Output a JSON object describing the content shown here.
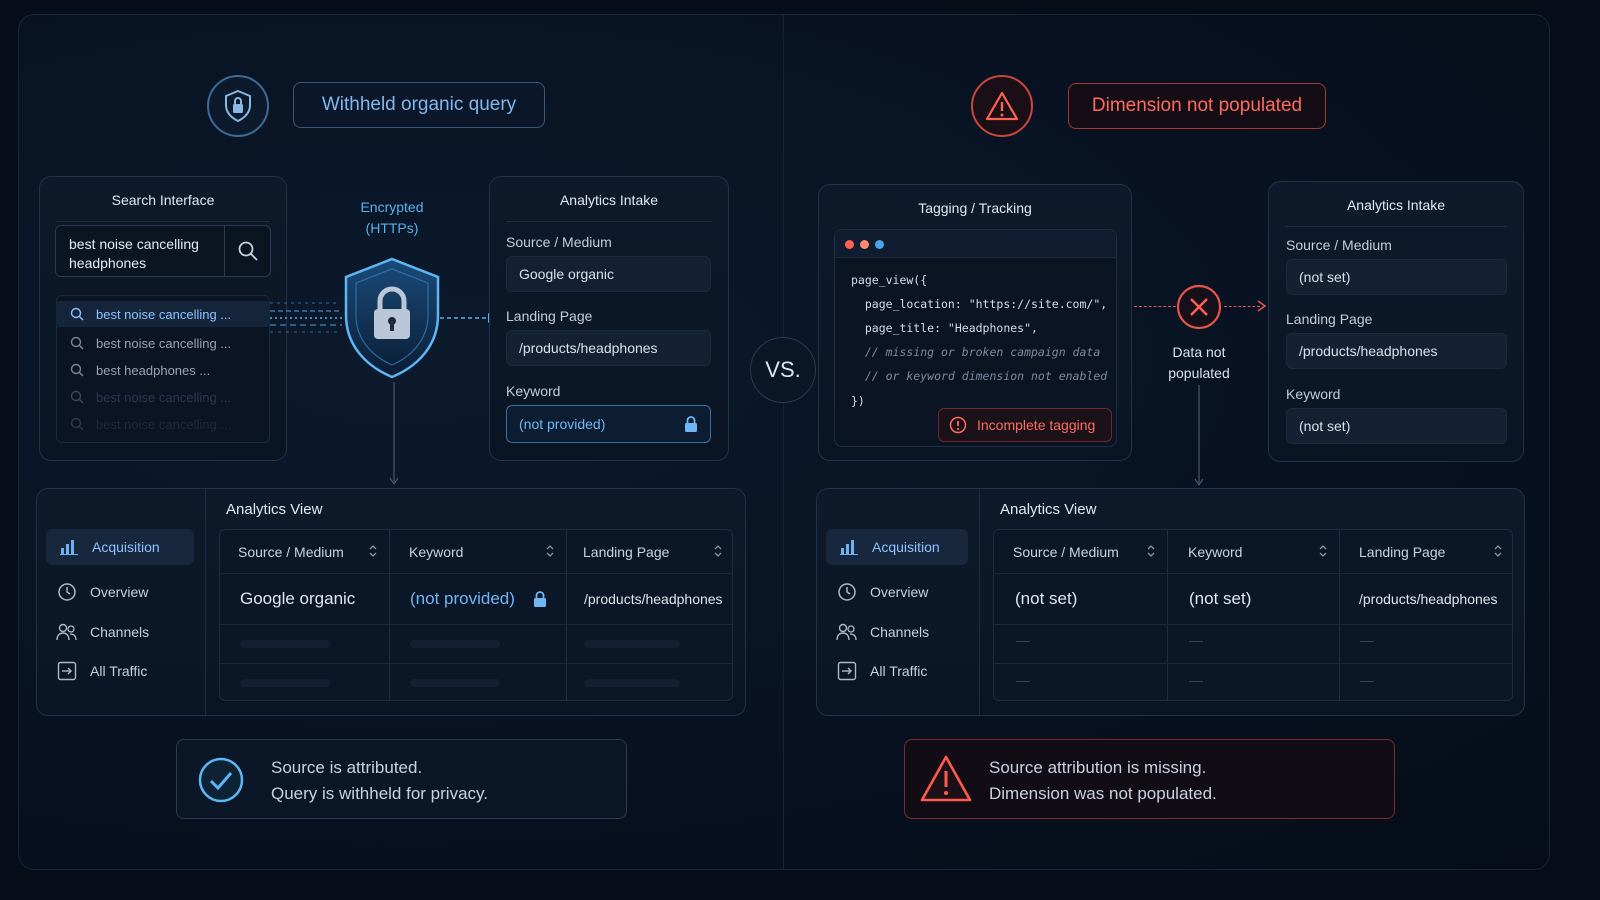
{
  "left": {
    "header_label": "Withheld organic query",
    "header_icon": "shield-lock-icon",
    "search_panel": {
      "title": "Search Interface",
      "query": "best noise cancelling headphones",
      "suggestions": [
        "best noise cancelling ...",
        "best noise cancelling ...",
        "best headphones ...",
        "best noise cancelling ...",
        "best noise cancelling ..."
      ]
    },
    "encryption_label": "Encrypted\n(HTTPs)",
    "intake": {
      "title": "Analytics Intake",
      "source_label": "Source / Medium",
      "source_value": "Google organic",
      "landing_label": "Landing Page",
      "landing_value": "/products/headphones",
      "keyword_label": "Keyword",
      "keyword_value": "(not provided)"
    },
    "view": {
      "title": "Analytics View",
      "nav": [
        "Acquisition",
        "Overview",
        "Channels",
        "All Traffic"
      ],
      "columns": [
        "Source / Medium",
        "Keyword",
        "Landing Page"
      ],
      "row": [
        "Google organic",
        "(not provided)",
        "/products/headphones"
      ]
    },
    "summary": [
      "Source is attributed.",
      "Query is withheld for privacy."
    ]
  },
  "vs_label": "VS.",
  "right": {
    "header_label": "Dimension not populated",
    "header_icon": "warning-triangle-icon",
    "tagging": {
      "title": "Tagging / Tracking",
      "code_lines": [
        "page_view({",
        "  page_location: \"https://site.com/\",",
        "  page_title: \"Headphones\",",
        "  // missing or broken campaign data",
        "  // or keyword dimension not enabled",
        "})"
      ],
      "warning": "Incomplete tagging"
    },
    "data_status": "Data not\npopulated",
    "intake": {
      "title": "Analytics Intake",
      "source_label": "Source / Medium",
      "source_value": "(not set)",
      "landing_label": "Landing Page",
      "landing_value": "/products/headphones",
      "keyword_label": "Keyword",
      "keyword_value": "(not set)"
    },
    "view": {
      "title": "Analytics View",
      "nav": [
        "Acquisition",
        "Overview",
        "Channels",
        "All Traffic"
      ],
      "columns": [
        "Source / Medium",
        "Keyword",
        "Landing Page"
      ],
      "row": [
        "(not set)",
        "(not set)",
        "/products/headphones"
      ],
      "empty_cell": "—"
    },
    "summary": [
      "Source attribution is missing.",
      "Dimension was not populated."
    ]
  },
  "colors": {
    "accent_blue": "#5fb0f0",
    "accent_red": "#e0574c",
    "background": "#060d18"
  }
}
